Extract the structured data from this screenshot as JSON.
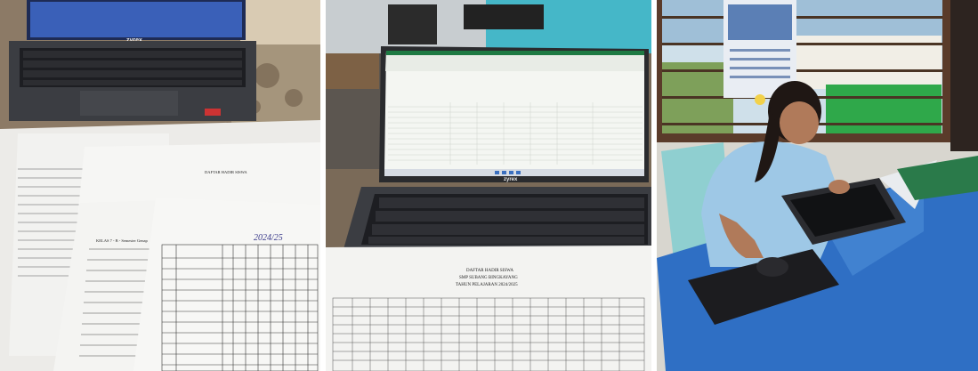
{
  "photos": [
    {
      "name": "attendance-sheets-photo",
      "laptop_brand": "zyrex",
      "sheet_title": "DAFTAR HADIR SISWA",
      "sheet_class_label": "KELAS 7 - B - Semester Genap",
      "handwritten_year": "2024/25"
    },
    {
      "name": "laptop-spreadsheet-photo",
      "laptop_brand": "zyrex",
      "sheet_title": "DAFTAR HADIR SISWA",
      "sheet_subtitle": "SMP SUBANG BINGKAYANG",
      "sheet_year_line": "TAHUN PELAJARAN 2024/2025"
    },
    {
      "name": "student-at-laptop-photo"
    }
  ],
  "colors": {
    "desk_blue": "#2f6fc4",
    "shirt_blue": "#9ec8e6",
    "wall_green": "#2fa84a",
    "paper": "#f3f3f1",
    "laptop_body": "#3b3d42",
    "keyboard": "#1d1e22"
  }
}
